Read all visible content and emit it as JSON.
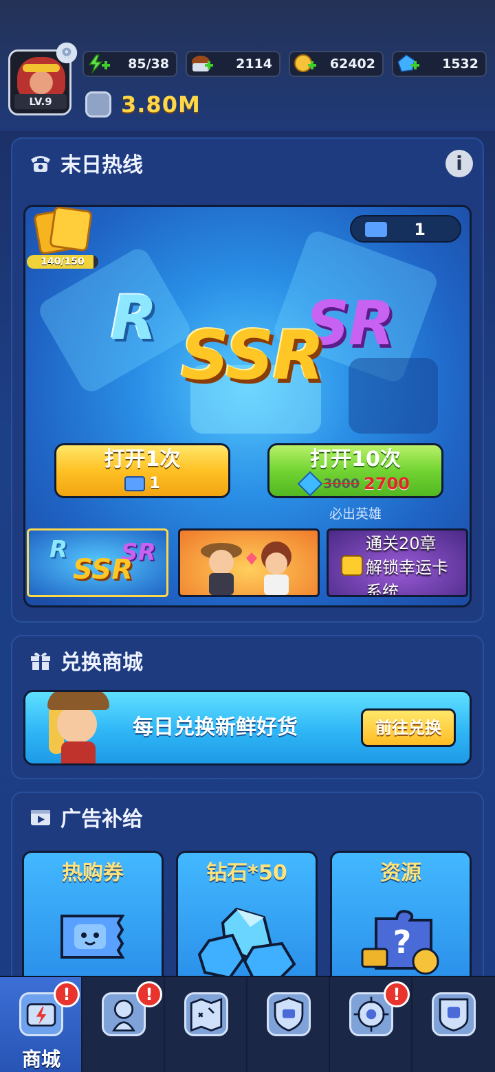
{
  "player": {
    "level": "LV.9",
    "power": "3.80M"
  },
  "resources": {
    "stamina": "85/38",
    "exp": "2114",
    "gold": "62402",
    "diamond": "1532"
  },
  "hotline": {
    "title": "末日热线",
    "ticket_count": "1",
    "card_progress": "140/150",
    "card_progress_value": 0.933,
    "rarity_labels": {
      "r": "R",
      "ssr": "SSR",
      "sr": "SR"
    },
    "open_once": {
      "label": "打开1次",
      "cost": "1"
    },
    "open_ten": {
      "label": "打开10次",
      "old_cost": "3000",
      "new_cost": "2700"
    },
    "guarantee": "必出英雄",
    "thumbnails": {
      "third_line1": "通关20章",
      "third_line2": "解锁幸运卡",
      "third_line3": "系统"
    }
  },
  "exchange": {
    "title": "兑换商城",
    "banner_text": "每日兑换新鲜好货",
    "button": "前往兑换"
  },
  "ads": {
    "title": "广告补给",
    "cards": [
      "热购券",
      "钻石*50",
      "资源"
    ]
  },
  "nav": {
    "items": [
      {
        "label": "商城",
        "icon": "shop-icon",
        "badge": "!"
      },
      {
        "label": "",
        "icon": "hero-icon",
        "badge": "!"
      },
      {
        "label": "",
        "icon": "map-icon",
        "badge": ""
      },
      {
        "label": "",
        "icon": "shield-icon",
        "badge": ""
      },
      {
        "label": "",
        "icon": "target-icon",
        "badge": "!"
      },
      {
        "label": "",
        "icon": "guild-icon",
        "badge": ""
      }
    ]
  },
  "colors": {
    "gold_text": "#ffd84a",
    "panel": "#1e3b80",
    "badge": "#e8342d"
  }
}
